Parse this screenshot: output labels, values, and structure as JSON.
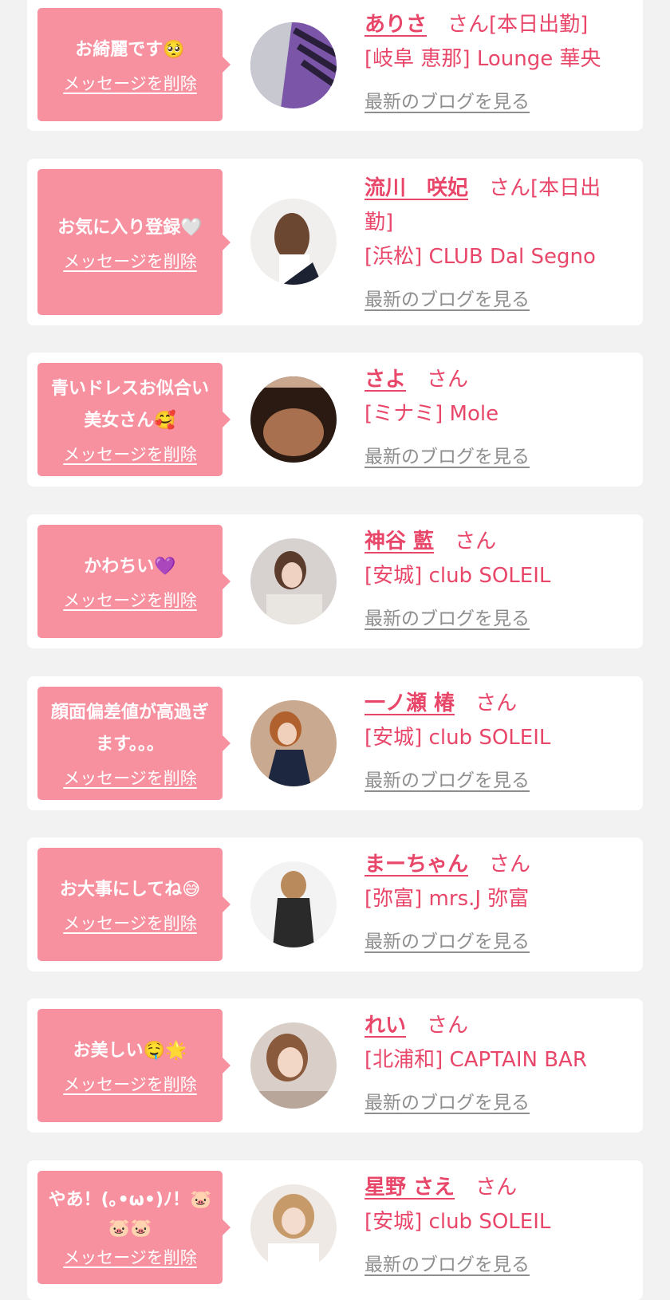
{
  "colors": {
    "background": "#f2f2f2",
    "card": "#ffffff",
    "bubble": "#f8919f",
    "accent": "#e8476a",
    "link_gray": "#8e8e8e"
  },
  "favorites": [
    {
      "message": "お綺麗です🥺",
      "delete_label": "メッセージを削除",
      "name": "ありさ",
      "suffix": "さん[本日出勤]",
      "shop": "[岐阜 恵那] Lounge 華央",
      "blog_label": "最新のブログを見る",
      "avatar_icon": "avatar-photo"
    },
    {
      "message": "お気に入り登録🤍",
      "delete_label": "メッセージを削除",
      "name": "流川　咲妃",
      "suffix": "さん[本日出勤]",
      "shop": "[浜松] CLUB Dal Segno",
      "blog_label": "最新のブログを見る",
      "avatar_icon": "avatar-photo"
    },
    {
      "message": "青いドレスお似合い美女さん🥰",
      "delete_label": "メッセージを削除",
      "name": "さよ",
      "suffix": "さん",
      "shop": "[ミナミ] Mole",
      "blog_label": "最新のブログを見る",
      "avatar_icon": "avatar-photo"
    },
    {
      "message": "かわちい💜",
      "delete_label": "メッセージを削除",
      "name": "神谷 藍",
      "suffix": "さん",
      "shop": "[安城] club SOLEIL",
      "blog_label": "最新のブログを見る",
      "avatar_icon": "avatar-photo"
    },
    {
      "message": "顔面偏差値が高過ぎます。。。",
      "delete_label": "メッセージを削除",
      "name": "一ノ瀬 椿",
      "suffix": "さん",
      "shop": "[安城] club SOLEIL",
      "blog_label": "最新のブログを見る",
      "avatar_icon": "avatar-photo"
    },
    {
      "message": "お大事にしてね😅",
      "delete_label": "メッセージを削除",
      "name": "まーちゃん",
      "suffix": "さん",
      "shop": "[弥富] mrs.J 弥富",
      "blog_label": "最新のブログを見る",
      "avatar_icon": "avatar-photo"
    },
    {
      "message": "お美しい🤤🌟",
      "delete_label": "メッセージを削除",
      "name": "れい",
      "suffix": "さん",
      "shop": "[北浦和] CAPTAIN BAR",
      "blog_label": "最新のブログを見る",
      "avatar_icon": "avatar-photo"
    },
    {
      "message": "やあ！(｡•ω•)ﾉ！🐷🐷🐷",
      "delete_label": "メッセージを削除",
      "name": "星野 さえ",
      "suffix": "さん",
      "shop": "[安城] club SOLEIL",
      "blog_label": "最新のブログを見る",
      "avatar_icon": "avatar-photo"
    }
  ]
}
